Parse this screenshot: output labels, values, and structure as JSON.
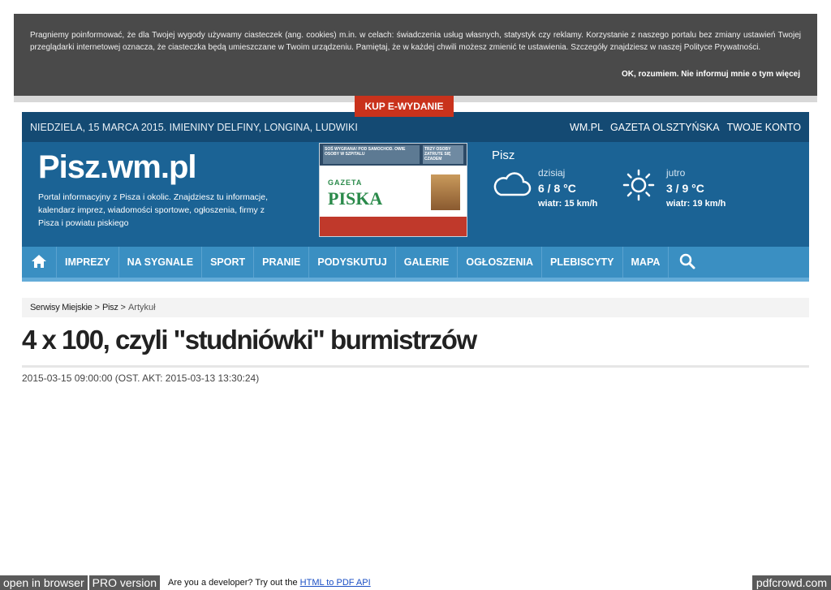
{
  "cookie": {
    "text": "Pragniemy poinformować, że dla Twojej wygody używamy ciasteczek (ang. cookies) m.in. w celach: świadczenia usług własnych, statystyk czy reklamy. Korzystanie z naszego portalu bez zmiany ustawień Twojej przeglądarki internetowej oznacza, że ciasteczka będą umieszczane w Twoim urządzeniu. Pamiętaj, że w każdej chwili możesz zmienić te ustawienia. Szczegóły znajdziesz w naszej Polityce Prywatności.",
    "accept_label": "OK, rozumiem. Nie informuj mnie o tym więcej"
  },
  "topbar": {
    "date_text": "NIEDZIELA, 15 MARCA 2015. IMIENINY DELFINY, LONGINA, LUDWIKI",
    "links": [
      "WM.PL",
      "GAZETA OLSZTYŃSKA",
      "TWOJE KONTO"
    ]
  },
  "site": {
    "title": "Pisz.wm.pl",
    "description": "Portal informacyjny z Pisza i okolic. Znajdziesz tu informacje, kalendarz imprez, wiadomości sportowe, ogłoszenia, firmy z Pisza i powiatu piskiego"
  },
  "cover": {
    "headline_left": "SOŚ WYGRANA! POD SAMOCHOD. OWIE OSOBY W SZPITALU",
    "headline_right": "TRZY OSOBY ZATRUTE SIĘ CZADEM",
    "logo_top": "GAZETA",
    "logo_bottom": "PISKA",
    "buy_label": "KUP E-WYDANIE"
  },
  "weather": {
    "city": "Pisz",
    "today": {
      "label": "dzisiaj",
      "temp": "6 / 8 °C",
      "wind": "wiatr: 15 km/h",
      "icon": "cloud-icon"
    },
    "tomorrow": {
      "label": "jutro",
      "temp": "3 / 9 °C",
      "wind": "wiatr: 19 km/h",
      "icon": "sun-icon"
    }
  },
  "nav": {
    "items": [
      "IMPREZY",
      "NA SYGNALE",
      "SPORT",
      "PRANIE",
      "PODYSKUTUJ",
      "GALERIE",
      "OGŁOSZENIA",
      "PLEBISCYTY",
      "MAPA"
    ]
  },
  "breadcrumb": {
    "items": [
      "Serwisy Miejskie",
      "Pisz",
      "Artykuł"
    ],
    "separator": ">"
  },
  "article": {
    "title": "4 x 100, czyli \"studniówki\" burmistrzów",
    "date": "2015-03-15 09:00:00 (OST. AKT: 2015-03-13 13:30:24)"
  },
  "pdfbar": {
    "open_label": "open in browser",
    "pro_label": "PRO version",
    "prompt": "Are you a developer? Try out the",
    "link_label": "HTML to PDF API",
    "brand": "pdfcrowd.com"
  },
  "colors": {
    "header_bg": "#1b6395",
    "topbar_bg": "#144a73",
    "nav_bg": "#3a8fc2",
    "buy_button": "#c9321c",
    "cookie_bg": "#4a4a4a"
  }
}
